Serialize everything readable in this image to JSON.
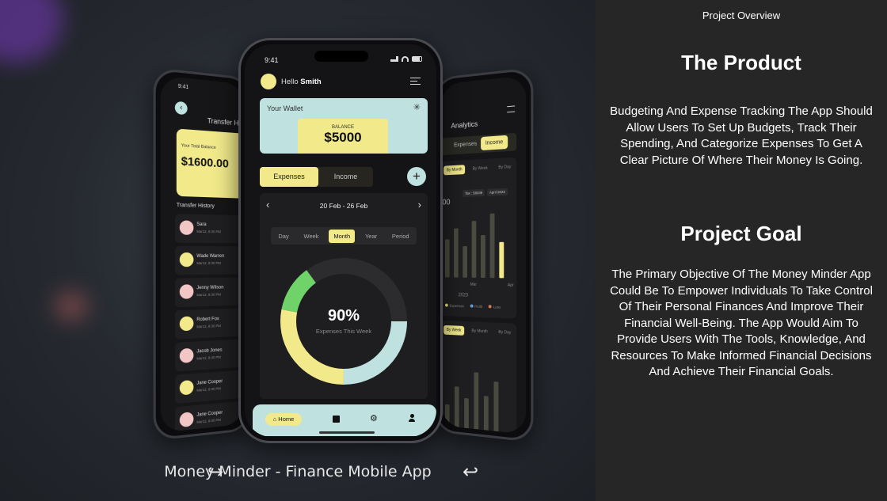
{
  "panel": {
    "overview_label": "Project Overview",
    "product_heading": "The Product",
    "product_text": "Budgeting And Expense Tracking The App Should Allow Users To Set Up Budgets, Track Their Spending, And Categorize Expenses To Get A Clear Picture Of Where Their Money Is Going.",
    "goal_heading": "Project Goal",
    "goal_text": "The Primary Objective Of The Money Minder App Could Be To Empower Individuals To Take Control Of Their Personal Finances And Improve Their Financial Well-Being. The App Would Aim To Provide Users With The Tools, Knowledge, And Resources To Make Informed Financial Decisions And Achieve Their Financial Goals."
  },
  "caption": "Money Minder - Finance Mobile App",
  "main_phone": {
    "time": "9:41",
    "greeting": "Hello",
    "user_name": "Smith",
    "wallet_label": "Your Wallet",
    "balance_label": "BALANCE",
    "balance_value": "$5000",
    "tab_expenses": "Expenses",
    "tab_income": "Income",
    "date_range": "20 Feb - 26 Feb",
    "periods": [
      "Day",
      "Week",
      "Month",
      "Year",
      "Period"
    ],
    "selected_period": "Month",
    "donut_percent": "90%",
    "donut_caption": "Expenses This Week",
    "donut_fraction": 0.9,
    "nav_home": "Home",
    "colors": {
      "teal": "#bfe2e0",
      "yellow": "#f1e98a",
      "green": "#6fd36a"
    }
  },
  "left_phone": {
    "time": "9:41",
    "title": "Transfer Hist",
    "total_label": "Your Total Balance",
    "total_value": "$1600.00",
    "history_label": "Transfer History",
    "people": [
      {
        "name": "Sara",
        "time": "Mar12, 8:30 PM"
      },
      {
        "name": "Wade Warren",
        "time": "Mar12, 8:30 PM"
      },
      {
        "name": "Jenny Wilson",
        "time": "Mar12, 8:30 PM"
      },
      {
        "name": "Robert Fox",
        "time": "Mar12, 8:30 PM"
      },
      {
        "name": "Jacob Jones",
        "time": "Mar12, 8:30 PM"
      },
      {
        "name": "Jane Cooper",
        "time": "Mar12, 8:30 PM"
      },
      {
        "name": "Jane Cooper",
        "time": "Mar12, 8:30 PM"
      }
    ]
  },
  "right_phone": {
    "title": "Analytics",
    "tab_expenses": "Expenses",
    "tab_income": "Income",
    "filters_top": [
      "By Month",
      "By Week",
      "By Day"
    ],
    "chips": [
      "Tax : 55039",
      "April 2023"
    ],
    "axis_value": "00",
    "months": [
      "Mar",
      "Apr"
    ],
    "year": "2023",
    "legend": [
      "Expenses",
      "Profit",
      "Loss"
    ],
    "filters_bottom": [
      "By Week",
      "By Month",
      "By Day"
    ],
    "bars_top": [
      0.55,
      0.7,
      0.45,
      0.8,
      0.6,
      0.9,
      0.5
    ],
    "bars_bottom": [
      0.4,
      0.65,
      0.5,
      0.85,
      0.55,
      0.75
    ]
  }
}
